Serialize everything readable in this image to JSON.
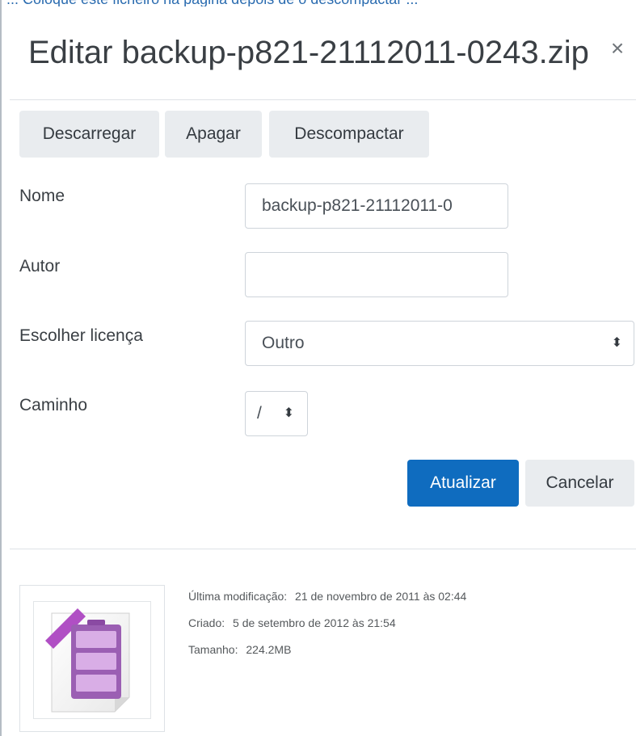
{
  "top_strip": {
    "text": "... Coloque este ficheiro na página depois de o descompactar ..."
  },
  "modal": {
    "title": "Editar backup-p821-21112011-0243.zip",
    "close_symbol": "×"
  },
  "toolbar": {
    "download_label": "Descarregar",
    "delete_label": "Apagar",
    "unzip_label": "Descompactar"
  },
  "form": {
    "name": {
      "label": "Nome",
      "value": "backup-p821-21112011-0"
    },
    "author": {
      "label": "Autor",
      "value": ""
    },
    "license": {
      "label": "Escolher licença",
      "value": "Outro"
    },
    "path": {
      "label": "Caminho",
      "value": "/"
    }
  },
  "actions": {
    "update_label": "Atualizar",
    "cancel_label": "Cancelar"
  },
  "file_info": {
    "modified_label": "Última modificação:",
    "modified_value": "21 de novembro de 2011 às 02:44",
    "created_label": "Criado:",
    "created_value": "5 de setembro de 2012 às 21:54",
    "size_label": "Tamanho:",
    "size_value": "224.2MB",
    "icon": "zip-archive-icon"
  },
  "colors": {
    "primary": "#0f6cbf",
    "secondary_button": "#e9ecef",
    "archive_icon_purple": "#b04fc4"
  }
}
